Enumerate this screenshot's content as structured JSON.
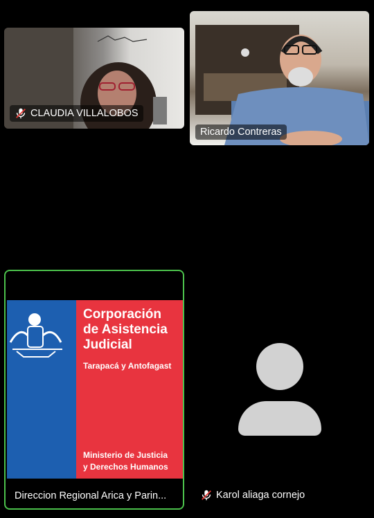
{
  "participants": [
    {
      "name": "CLAUDIA VILLALOBOS",
      "muted": true
    },
    {
      "name": "Ricardo Contreras",
      "muted": false
    },
    {
      "name": "Direccion Regional Arica y Parin...",
      "muted": false,
      "active_speaker": true,
      "logo": {
        "title_lines": [
          "Corporación",
          "de Asistencia",
          "Judicial"
        ],
        "subtitle": "Tarapacá y Antofagast",
        "ministry_lines": [
          "Ministerio de Justicia",
          "y Derechos Humanos"
        ]
      }
    },
    {
      "name": "Karol aliaga cornejo",
      "muted": true
    }
  ],
  "colors": {
    "active_border": "#4cc24c",
    "logo_blue": "#1d5fb0",
    "logo_red": "#e8343f"
  },
  "icons": {
    "mic_off": "microphone-off-icon",
    "avatar": "user-avatar-icon"
  }
}
